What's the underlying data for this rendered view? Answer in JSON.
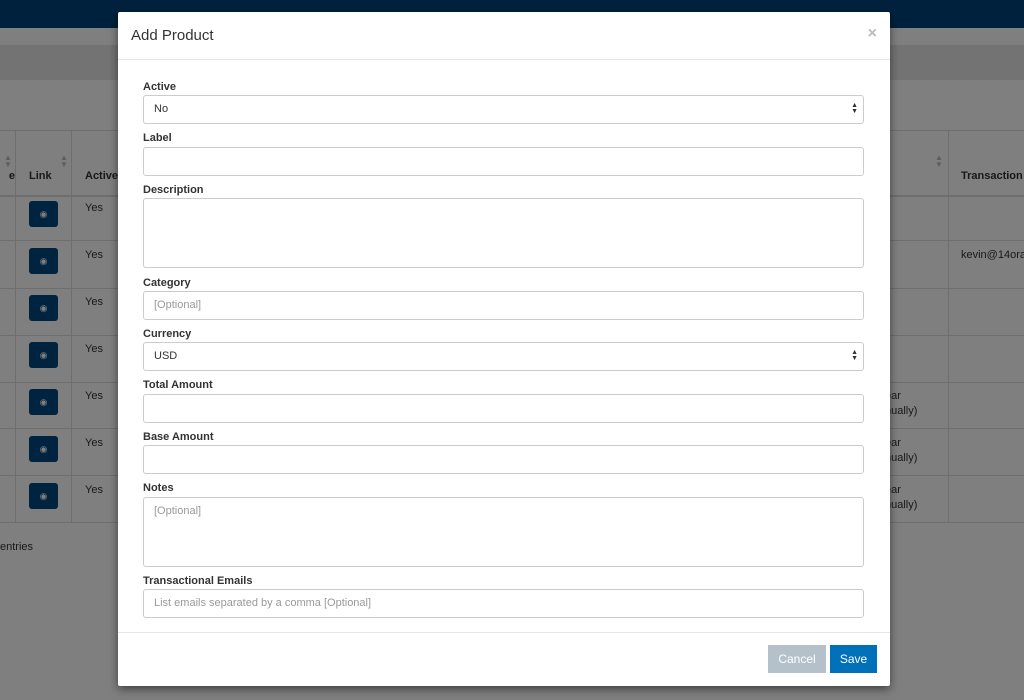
{
  "background": {
    "table": {
      "headers": [
        "e",
        "Link",
        "Active",
        "Transaction"
      ],
      "rows": [
        {
          "active": "Yes",
          "right": "",
          "transaction": ""
        },
        {
          "active": "Yes",
          "right": "",
          "transaction": "kevin@14ora"
        },
        {
          "active": "Yes",
          "right": "",
          "transaction": ""
        },
        {
          "active": "Yes",
          "right": "",
          "transaction": ""
        },
        {
          "active": "Yes",
          "right": "ear\nnually)",
          "transaction": ""
        },
        {
          "active": "Yes",
          "right": "ear\nnually)",
          "transaction": ""
        },
        {
          "active": "Yes",
          "right": "ear\nnually)",
          "transaction": ""
        }
      ],
      "footer": "entries"
    }
  },
  "modal": {
    "title": "Add Product",
    "close": "×",
    "fields": {
      "active": {
        "label": "Active",
        "value": "No"
      },
      "label": {
        "label": "Label",
        "value": ""
      },
      "description": {
        "label": "Description",
        "value": ""
      },
      "category": {
        "label": "Category",
        "placeholder": "[Optional]"
      },
      "currency": {
        "label": "Currency",
        "value": "USD"
      },
      "total_amount": {
        "label": "Total Amount",
        "value": ""
      },
      "base_amount": {
        "label": "Base Amount",
        "value": ""
      },
      "notes": {
        "label": "Notes",
        "placeholder": "[Optional]"
      },
      "transactional_emails": {
        "label": "Transactional Emails",
        "placeholder": "List emails separated by a comma [Optional]"
      }
    },
    "cancel": "Cancel",
    "save": "Save"
  },
  "colors": {
    "primary": "#0070b8",
    "cancel": "#b4c1cb",
    "navbar": "#00437a"
  }
}
